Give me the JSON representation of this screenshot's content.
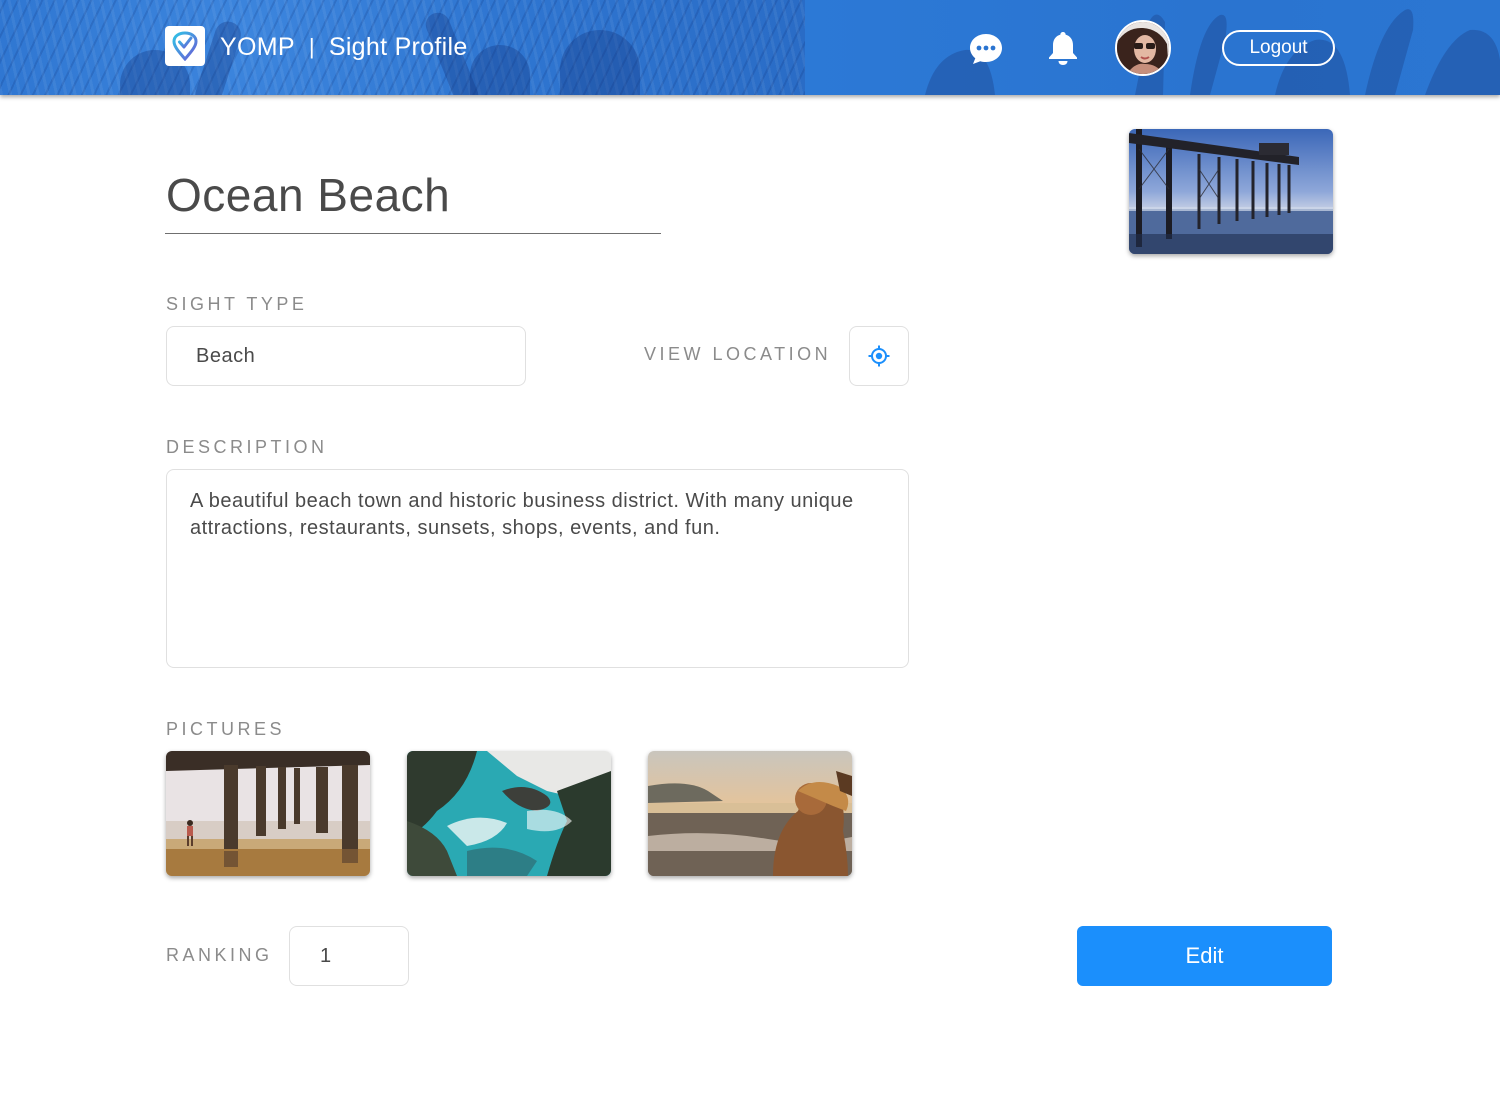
{
  "header": {
    "app_name": "YOMP",
    "separator": "|",
    "page_name": "Sight Profile",
    "logout_label": "Logout",
    "icons": [
      "yomp-logo-icon",
      "chat-bubble-icon",
      "bell-icon",
      "avatar"
    ]
  },
  "sight": {
    "title": "Ocean Beach",
    "sight_type_label": "SIGHT TYPE",
    "sight_type_value": "Beach",
    "view_location_label": "VIEW LOCATION",
    "description_label": "DESCRIPTION",
    "description_value": "A beautiful beach town and historic business district. With many unique attractions, restaurants, sunsets, shops, events, and fun.",
    "pictures_label": "PICTURES",
    "ranking_label": "RANKING",
    "ranking_value": "1",
    "edit_label": "Edit"
  },
  "colors": {
    "header_blue": "#2a73cc",
    "accent_blue": "#1b8ffc",
    "text": "#4a4a4a",
    "label_grey": "#8b8b8b"
  }
}
